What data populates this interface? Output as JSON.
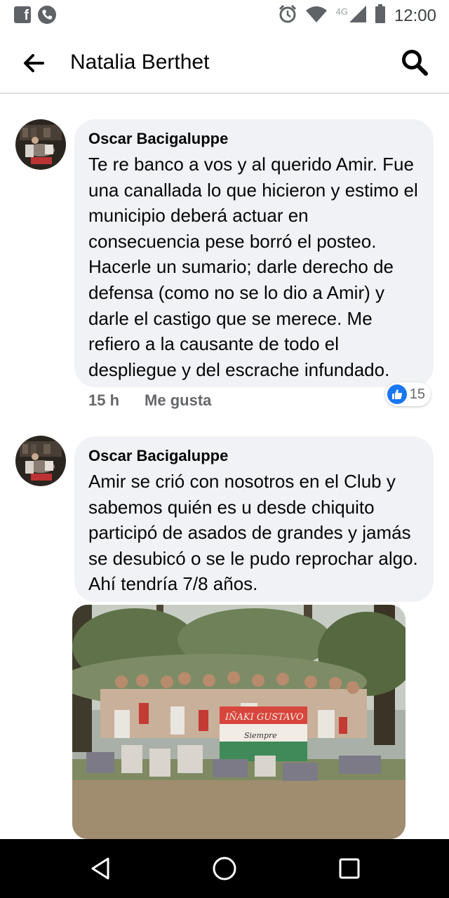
{
  "status_bar": {
    "time": "12:00",
    "network": "4G",
    "left_icons": [
      "facebook-icon",
      "phone-icon"
    ],
    "right_icons": [
      "alarm-icon",
      "wifi-icon",
      "signal-icon",
      "battery-icon"
    ]
  },
  "app_bar": {
    "title": "Natalia Berthet",
    "back_icon": "arrow-left-icon",
    "search_icon": "search-icon"
  },
  "comments": [
    {
      "author": "Oscar Bacigaluppe",
      "text": "Te re banco a vos y al querido Amir. Fue una canallada lo que hicieron y estimo el municipio deberá actuar en consecuencia pese borró el posteo. Hacerle un sumario; darle derecho de defensa (como no se lo dio a Amir) y darle el castigo que se merece. Me refiero a la causante de todo el despliegue y del escrache infundado.",
      "time": "15 h",
      "like_label": "Me gusta",
      "reaction_count": "15"
    },
    {
      "author": "Oscar Bacigaluppe",
      "text": "Amir se crió con nosotros en el Club y sabemos quién es u desde chiquito participó de asados de grandes y jamás se desubicó o se le pudo reprochar algo. Ahí tendría 7/8 años."
    }
  ],
  "photo": {
    "banner_text": "IÑAKI GUSTAVO",
    "banner_subtext": "Siempre"
  },
  "colors": {
    "bubble": "#f0f2f5",
    "like_blue": "#1877f2",
    "meta_gray": "#65676b"
  },
  "nav_bar": {
    "icons": [
      "back-triangle-icon",
      "home-circle-icon",
      "recents-square-icon"
    ]
  }
}
